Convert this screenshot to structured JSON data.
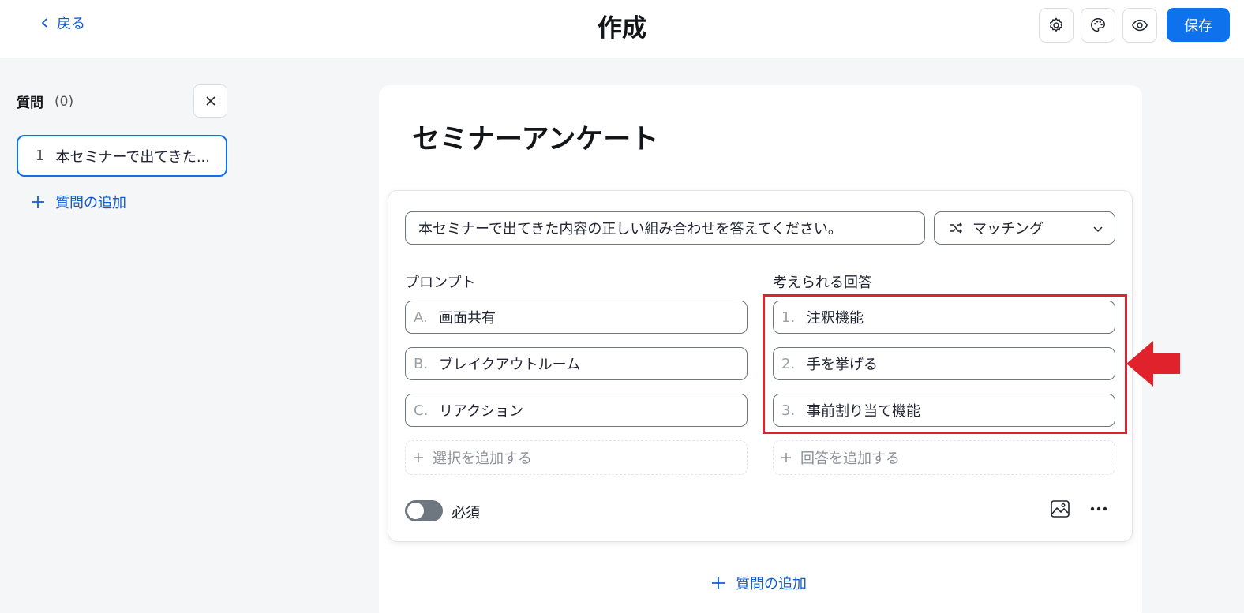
{
  "header": {
    "back_label": "戻る",
    "title": "作成",
    "save_label": "保存",
    "icons": [
      "gear-icon",
      "palette-icon",
      "eye-icon"
    ]
  },
  "sidebar": {
    "title": "質問",
    "count": "(0)",
    "items": [
      {
        "num": "1",
        "label": "本セミナーで出てきた..."
      }
    ],
    "add_question": "質問の追加"
  },
  "survey": {
    "title": "セミナーアンケート",
    "question": {
      "text": "本セミナーで出てきた内容の正しい組み合わせを答えてください。",
      "type": "マッチング",
      "prompts_label": "プロンプト",
      "answers_label": "考えられる回答",
      "prompts": [
        {
          "letter": "A.",
          "text": "画面共有"
        },
        {
          "letter": "B.",
          "text": "ブレイクアウトルーム"
        },
        {
          "letter": "C.",
          "text": "リアクション"
        }
      ],
      "answers": [
        {
          "letter": "1.",
          "text": "注釈機能"
        },
        {
          "letter": "2.",
          "text": "手を挙げる"
        },
        {
          "letter": "3.",
          "text": "事前割り当て機能"
        }
      ],
      "add_prompt": "選択を追加する",
      "add_answer": "回答を追加する",
      "required_label": "必須",
      "required": false
    },
    "add_question": "質問の追加"
  },
  "colors": {
    "accent": "#0e72ed",
    "link": "#0e5bd8",
    "highlight": "#e0222d"
  }
}
